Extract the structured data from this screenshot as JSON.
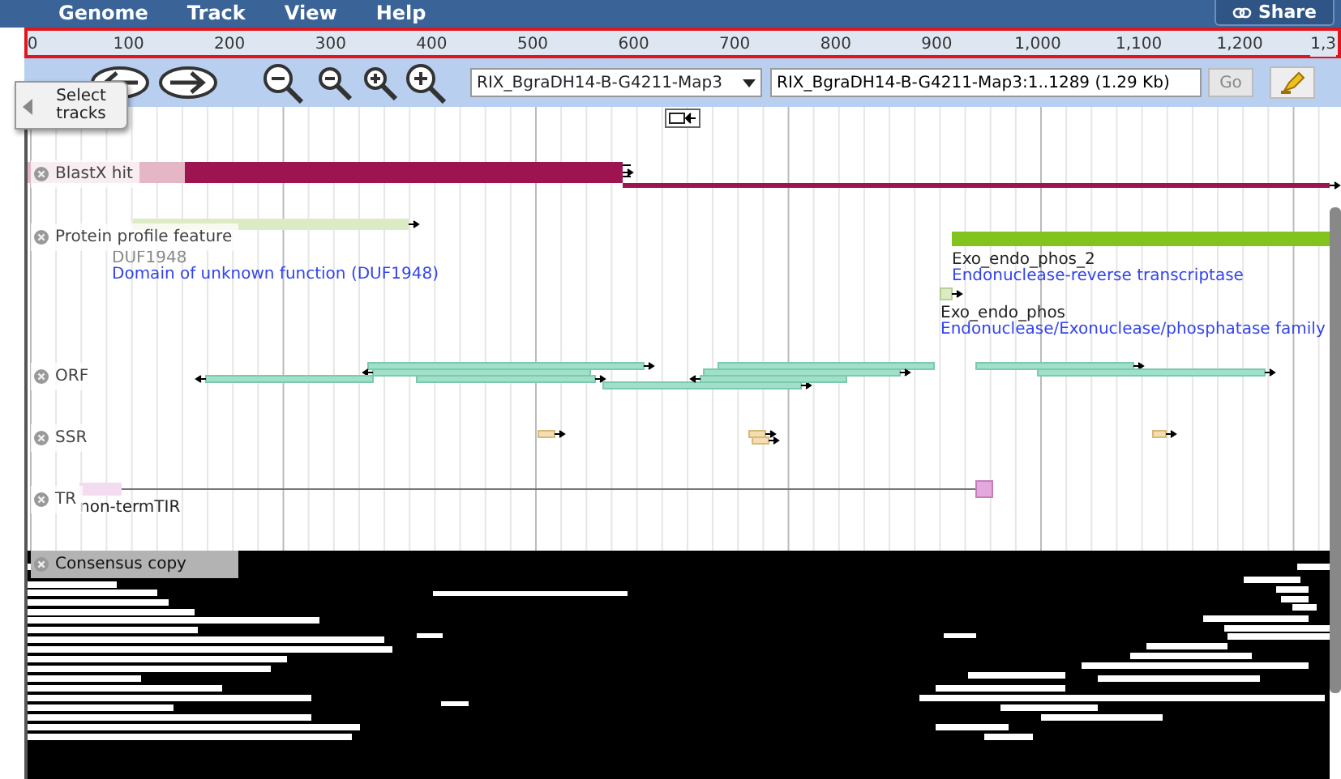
{
  "menu": [
    {
      "label": "Genome"
    },
    {
      "label": "Track"
    },
    {
      "label": "View"
    },
    {
      "label": "Help"
    }
  ],
  "share_button": "Share",
  "ruler": {
    "highlighted": true,
    "ticks": [
      "0",
      "100",
      "200",
      "300",
      "400",
      "500",
      "600",
      "700",
      "800",
      "900",
      "1,000",
      "1,100",
      "1,200",
      "1,3"
    ]
  },
  "toolbar": {
    "reference_select": "RIX_BgraDH14-B-G4211-Map3",
    "location": "RIX_BgraDH14-B-G4211-Map3:1..1289 (1.29 Kb)",
    "go_button": "Go"
  },
  "select_tracks": "Select tracks",
  "tracks": [
    {
      "label": "BlastX hit",
      "kind": "blastx"
    },
    {
      "label": "Protein profile feature",
      "kind": "protein",
      "features": [
        {
          "name": "DUF1948",
          "description": "Domain of unknown function (DUF1948)"
        },
        {
          "name": "Exo_endo_phos_2",
          "description": "Endonuclease-reverse transcriptase"
        },
        {
          "name": "Exo_endo_phos",
          "description": "Endonuclease/Exonuclease/phosphatase family"
        }
      ]
    },
    {
      "label": "ORF",
      "kind": "orf"
    },
    {
      "label": "SSR",
      "kind": "ssr"
    },
    {
      "label": "TR",
      "kind": "tr",
      "features": [
        {
          "name": "non-termTIR"
        }
      ]
    },
    {
      "label": "Consensus copy",
      "kind": "consensus"
    }
  ]
}
